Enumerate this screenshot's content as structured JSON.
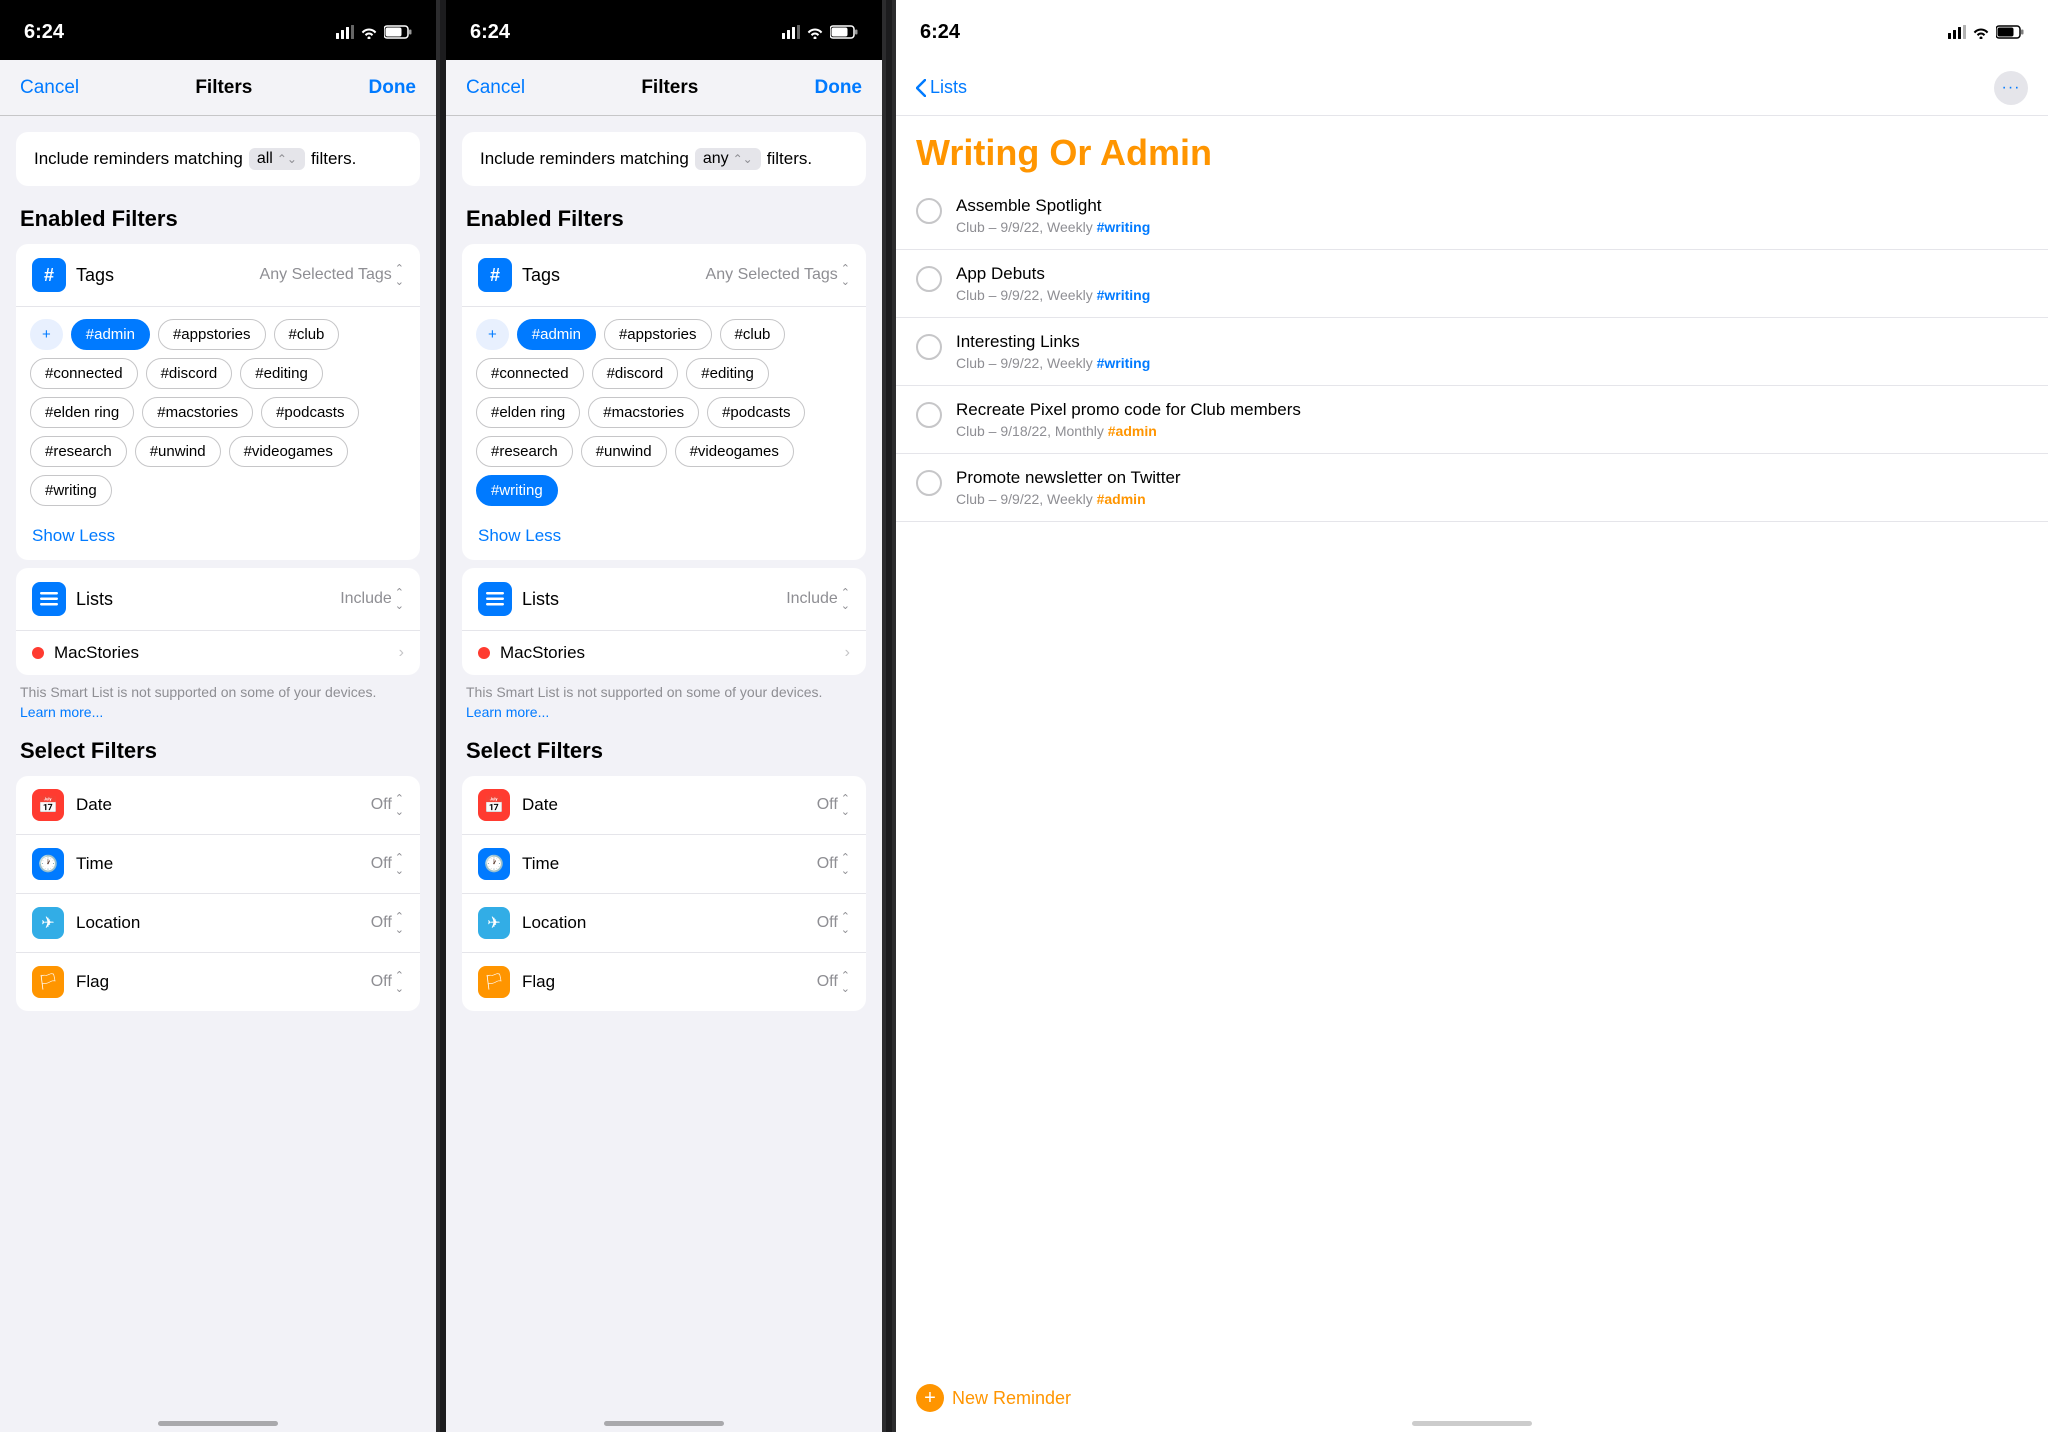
{
  "screens": [
    {
      "id": "screen1",
      "statusBar": {
        "time": "6:24",
        "bg": "dark"
      },
      "nav": {
        "cancel": "Cancel",
        "title": "Filters",
        "done": "Done"
      },
      "filterMatch": {
        "prefix": "Include reminders matching",
        "value": "all",
        "suffix": "filters."
      },
      "enabledFilters": {
        "heading": "Enabled Filters",
        "tags": {
          "label": "Tags",
          "value": "Any Selected Tags",
          "chips": [
            {
              "text": "#admin",
              "selected": true
            },
            {
              "text": "#appstories",
              "selected": false
            },
            {
              "text": "#club",
              "selected": false
            },
            {
              "text": "#connected",
              "selected": false
            },
            {
              "text": "#discord",
              "selected": false
            },
            {
              "text": "#editing",
              "selected": false
            },
            {
              "text": "#elden ring",
              "selected": false
            },
            {
              "text": "#macstories",
              "selected": false
            },
            {
              "text": "#podcasts",
              "selected": false
            },
            {
              "text": "#research",
              "selected": false
            },
            {
              "text": "#unwind",
              "selected": false
            },
            {
              "text": "#videogames",
              "selected": false
            },
            {
              "text": "#writing",
              "selected": false
            }
          ],
          "showLess": "Show Less"
        },
        "lists": {
          "label": "Lists",
          "value": "Include",
          "macstories": "MacStories",
          "warning": "This Smart List is not supported on some of your devices.",
          "learnMore": "Learn more..."
        }
      },
      "selectFilters": {
        "heading": "Select Filters",
        "items": [
          {
            "name": "Date",
            "status": "Off",
            "iconColor": "red",
            "icon": "📅"
          },
          {
            "name": "Time",
            "status": "Off",
            "iconColor": "blue",
            "icon": "🕐"
          },
          {
            "name": "Location",
            "status": "Off",
            "iconColor": "teal",
            "icon": "✈"
          },
          {
            "name": "Flag",
            "status": "Off",
            "iconColor": "orange",
            "icon": "🏳"
          }
        ]
      }
    },
    {
      "id": "screen2",
      "statusBar": {
        "time": "6:24",
        "bg": "dark"
      },
      "nav": {
        "cancel": "Cancel",
        "title": "Filters",
        "done": "Done"
      },
      "filterMatch": {
        "prefix": "Include reminders matching",
        "value": "any",
        "suffix": "filters."
      },
      "enabledFilters": {
        "heading": "Enabled Filters",
        "tags": {
          "label": "Tags",
          "value": "Any Selected Tags",
          "chips": [
            {
              "text": "#admin",
              "selected": true
            },
            {
              "text": "#appstories",
              "selected": false
            },
            {
              "text": "#club",
              "selected": false
            },
            {
              "text": "#connected",
              "selected": false
            },
            {
              "text": "#discord",
              "selected": false
            },
            {
              "text": "#editing",
              "selected": false
            },
            {
              "text": "#elden ring",
              "selected": false
            },
            {
              "text": "#macstories",
              "selected": false
            },
            {
              "text": "#podcasts",
              "selected": false
            },
            {
              "text": "#research",
              "selected": false
            },
            {
              "text": "#unwind",
              "selected": false
            },
            {
              "text": "#videogames",
              "selected": false
            },
            {
              "text": "#writing",
              "selected": true
            }
          ],
          "showLess": "Show Less"
        },
        "lists": {
          "label": "Lists",
          "value": "Include",
          "macstories": "MacStories",
          "warning": "This Smart List is not supported on some of your devices.",
          "learnMore": "Learn more..."
        }
      },
      "selectFilters": {
        "heading": "Select Filters",
        "items": [
          {
            "name": "Date",
            "status": "Off",
            "iconColor": "red",
            "icon": "📅"
          },
          {
            "name": "Time",
            "status": "Off",
            "iconColor": "blue",
            "icon": "🕐"
          },
          {
            "name": "Location",
            "status": "Off",
            "iconColor": "teal",
            "icon": "✈"
          },
          {
            "name": "Flag",
            "status": "Off",
            "iconColor": "orange",
            "icon": "🏳"
          }
        ]
      }
    }
  ],
  "thirdScreen": {
    "statusBar": {
      "time": "6:24"
    },
    "nav": {
      "back": "Lists",
      "moreIcon": "···"
    },
    "title": "Writing Or Admin",
    "reminders": [
      {
        "name": "Assemble Spotlight",
        "subtitle": "Club – 9/9/22, Weekly",
        "tag": "#writing",
        "tagClass": "writing"
      },
      {
        "name": "App Debuts",
        "subtitle": "Club – 9/9/22, Weekly",
        "tag": "#writing",
        "tagClass": "writing"
      },
      {
        "name": "Interesting Links",
        "subtitle": "Club – 9/9/22, Weekly",
        "tag": "#writing",
        "tagClass": "writing"
      },
      {
        "name": "Recreate Pixel promo code for Club members",
        "subtitle": "Club – 9/18/22, Monthly",
        "tag": "#admin",
        "tagClass": "admin"
      },
      {
        "name": "Promote newsletter on Twitter",
        "subtitle": "Club – 9/9/22, Weekly",
        "tag": "#admin",
        "tagClass": "admin"
      }
    ],
    "newReminder": "New Reminder"
  }
}
